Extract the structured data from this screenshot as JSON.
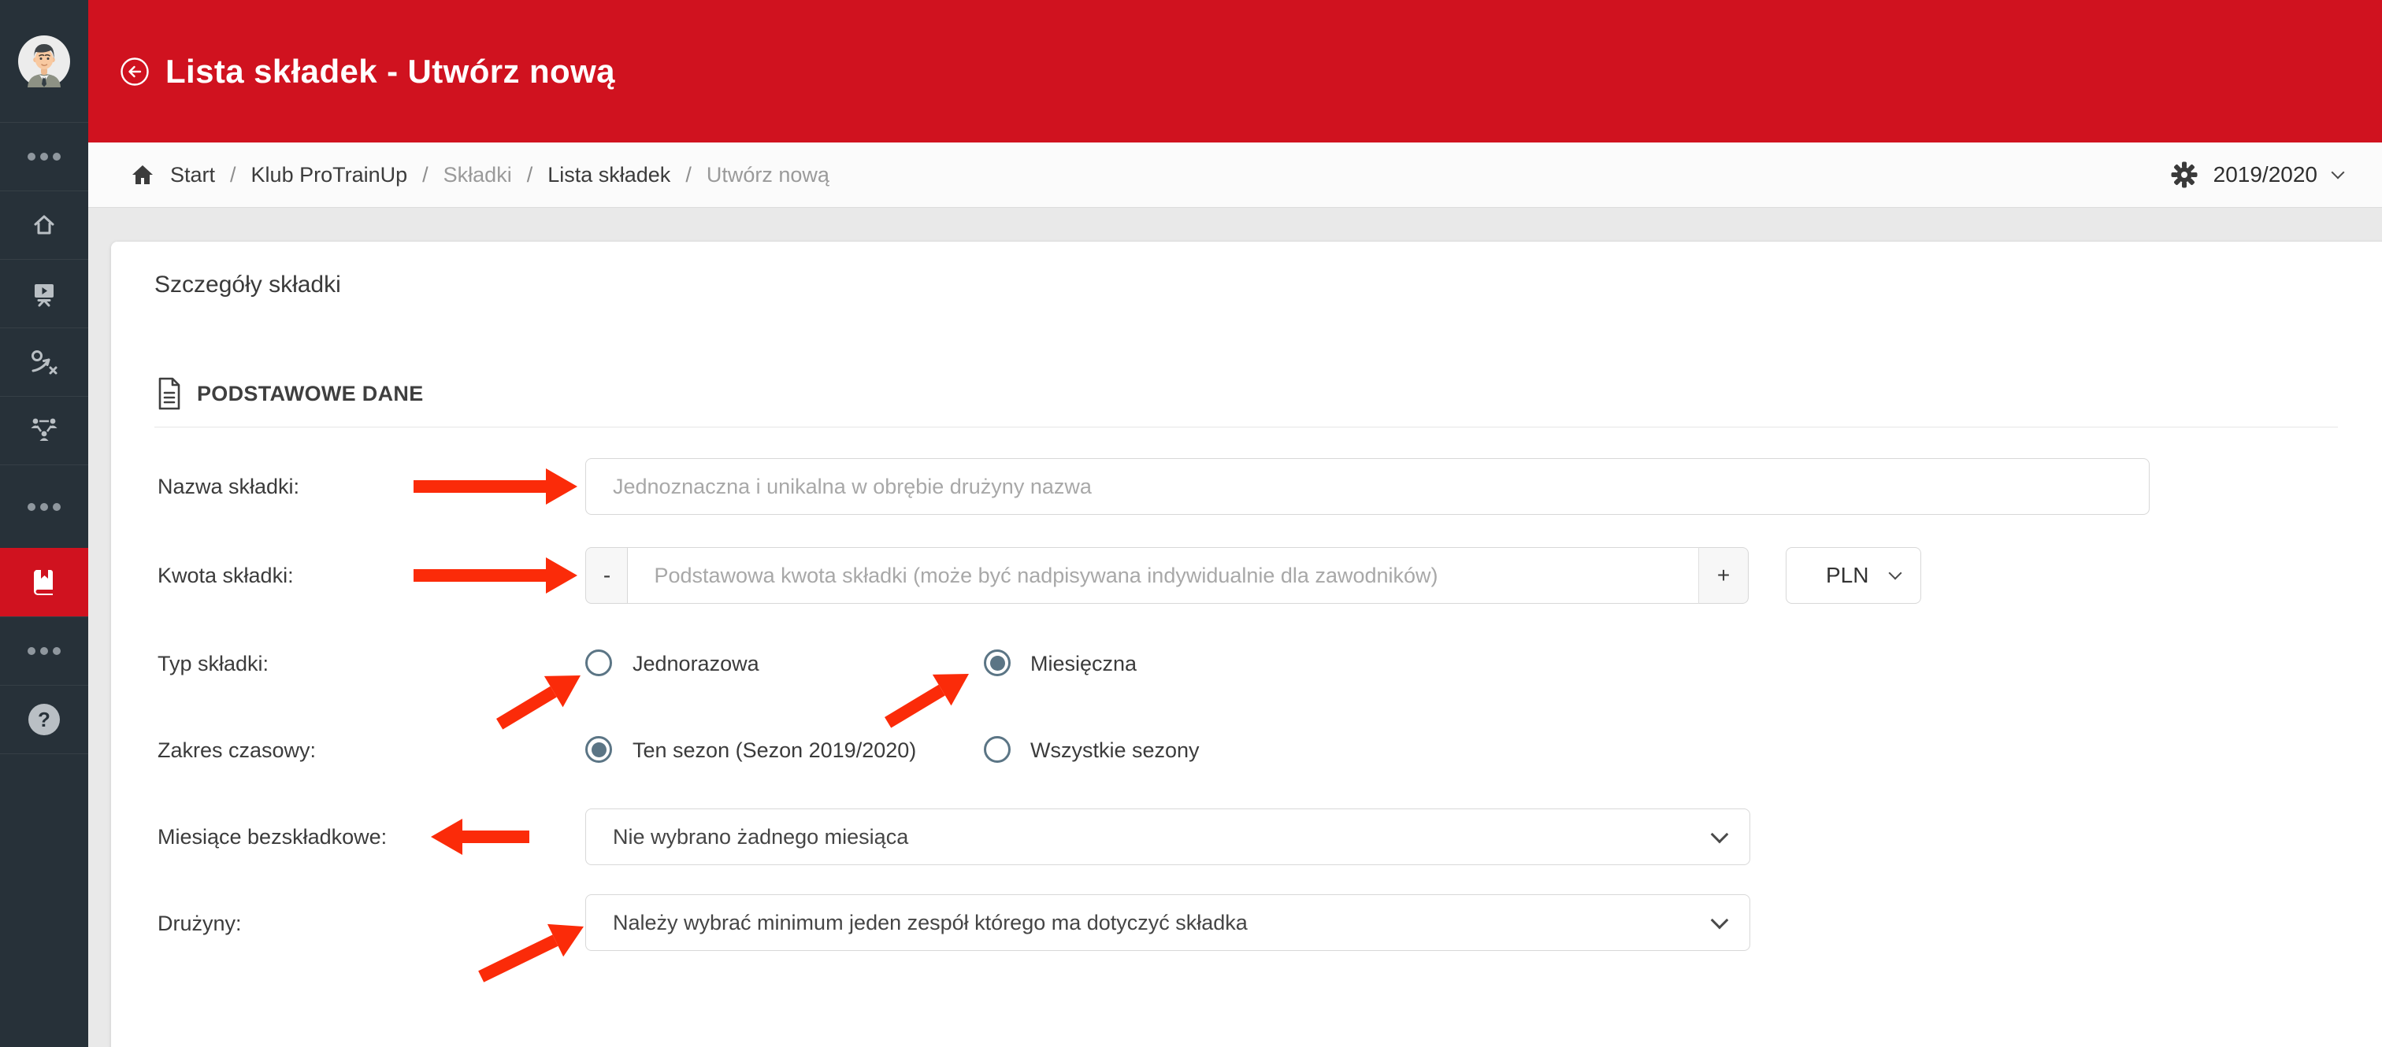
{
  "colors": {
    "accent_red": "#d0121f",
    "arrow_red": "#fb2b09",
    "radio_slate": "#5b7585",
    "sidebar_dark": "#273139"
  },
  "header": {
    "title": "Lista składek - Utwórz nową"
  },
  "breadcrumb": {
    "separator": "/",
    "items": [
      {
        "label": "Start",
        "muted": false
      },
      {
        "label": "Klub ProTrainUp",
        "muted": false
      },
      {
        "label": "Składki",
        "muted": true
      },
      {
        "label": "Lista składek",
        "muted": false
      },
      {
        "label": "Utwórz nową",
        "muted": true
      }
    ],
    "season": "2019/2020"
  },
  "sidebar": {
    "help_glyph": "?"
  },
  "page": {
    "card_title": "Szczegóły składki",
    "section_title": "PODSTAWOWE DANE"
  },
  "form": {
    "nazwa": {
      "label": "Nazwa składki:",
      "placeholder": "Jednoznaczna i unikalna w obrębie drużyny nazwa",
      "value": ""
    },
    "kwota": {
      "label": "Kwota składki:",
      "placeholder": "Podstawowa kwota składki (może być nadpisywana indywidualnie dla zawodników)",
      "value": "",
      "minus": "-",
      "plus": "+",
      "currency": "PLN"
    },
    "typ": {
      "label": "Typ składki:",
      "options": [
        {
          "label": "Jednorazowa",
          "selected": false
        },
        {
          "label": "Miesięczna",
          "selected": true
        }
      ]
    },
    "zakres": {
      "label": "Zakres czasowy:",
      "options": [
        {
          "label": "Ten sezon (Sezon 2019/2020)",
          "selected": true
        },
        {
          "label": "Wszystkie sezony",
          "selected": false
        }
      ]
    },
    "miesiace": {
      "label": "Miesiące bezskładkowe:",
      "value": "Nie wybrano żadnego miesiąca"
    },
    "druzyny": {
      "label": "Drużyny:",
      "value": "Należy wybrać minimum jeden zespół którego ma dotyczyć składka"
    }
  }
}
